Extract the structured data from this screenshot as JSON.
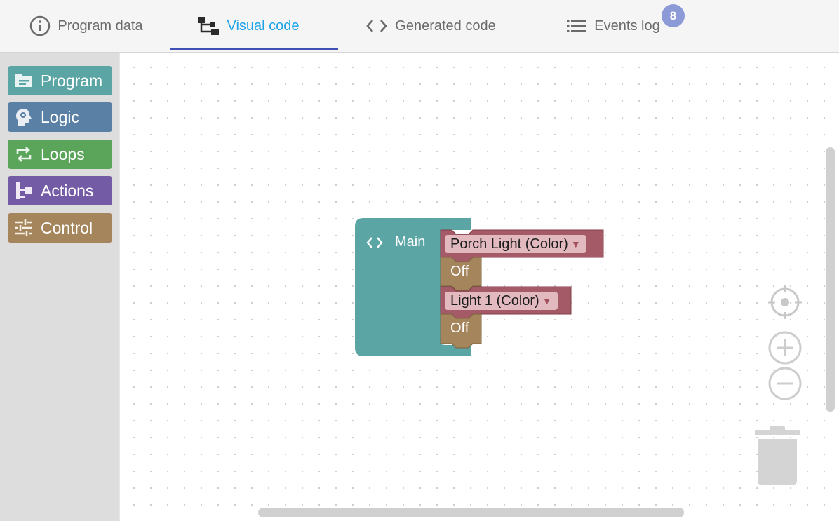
{
  "tabs": [
    {
      "label": "Program data",
      "icon": "info-icon",
      "active": false
    },
    {
      "label": "Visual code",
      "icon": "visual-code-icon",
      "active": true
    },
    {
      "label": "Generated code",
      "icon": "code-icon",
      "active": false
    },
    {
      "label": "Events log",
      "icon": "list-icon",
      "active": false,
      "badge": "8"
    }
  ],
  "toolbox": {
    "categories": [
      {
        "label": "Program",
        "icon": "folder-icon",
        "color": "#5ba5a5"
      },
      {
        "label": "Logic",
        "icon": "brain-gear-icon",
        "color": "#5b80a5"
      },
      {
        "label": "Loops",
        "icon": "repeat-icon",
        "color": "#5ba55b"
      },
      {
        "label": "Actions",
        "icon": "hierarchy-icon",
        "color": "#745ba5"
      },
      {
        "label": "Control",
        "icon": "sliders-icon",
        "color": "#a5855b"
      }
    ]
  },
  "workspace": {
    "main_block": {
      "label": "Main",
      "icon": "code-brackets-icon",
      "color": "#5ba5a5"
    },
    "statements": [
      {
        "device": "Porch Light (Color)",
        "value": "Off",
        "device_color": "#a55b67",
        "value_color": "#a5855b"
      },
      {
        "device": "Light 1 (Color)",
        "value": "Off",
        "device_color": "#a55b67",
        "value_color": "#a5855b"
      }
    ],
    "controls": [
      "recenter-icon",
      "zoom-in-icon",
      "zoom-out-icon",
      "trash-icon"
    ]
  }
}
